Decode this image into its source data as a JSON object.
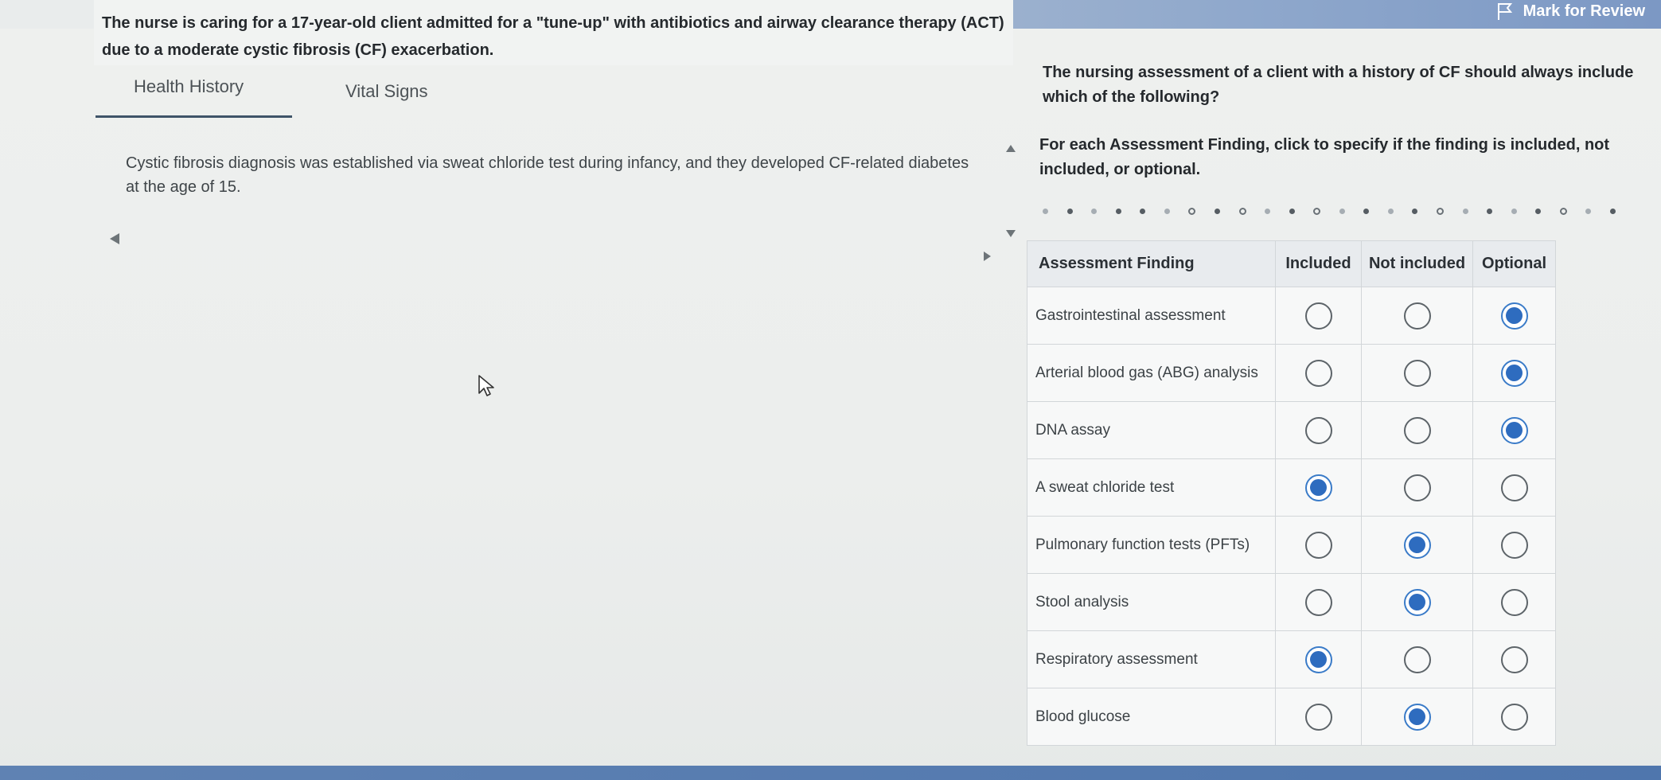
{
  "header": {
    "mark_for_review": "Mark for Review",
    "accent_color": "#2e6cbf"
  },
  "stem": "The nurse is caring for a 17-year-old client admitted for a \"tune-up\" with antibiotics and airway clearance therapy (ACT) due to a moderate cystic fibrosis (CF) exacerbation.",
  "tabs": {
    "health_history": "Health History",
    "vital_signs": "Vital Signs"
  },
  "health_history_text": "Cystic fibrosis diagnosis was established via sweat chloride test during infancy, and they developed CF-related diabetes at the age of 15.",
  "question": "The nursing assessment of a client with a history of CF should always include which of the following?",
  "instruction": "For each Assessment Finding, click to specify if the finding is included, not included, or optional.",
  "matrix": {
    "headers": {
      "finding": "Assessment Finding",
      "included": "Included",
      "not_included": "Not included",
      "optional": "Optional"
    },
    "rows": [
      {
        "finding": "Gastrointestinal assessment",
        "selected": "optional"
      },
      {
        "finding": "Arterial blood gas (ABG) analysis",
        "selected": "optional"
      },
      {
        "finding": "DNA assay",
        "selected": "optional"
      },
      {
        "finding": "A sweat chloride test",
        "selected": "included"
      },
      {
        "finding": "Pulmonary function tests (PFTs)",
        "selected": "not_included"
      },
      {
        "finding": "Stool analysis",
        "selected": "not_included"
      },
      {
        "finding": "Respiratory assessment",
        "selected": "included"
      },
      {
        "finding": "Blood glucose",
        "selected": "not_included"
      }
    ]
  }
}
